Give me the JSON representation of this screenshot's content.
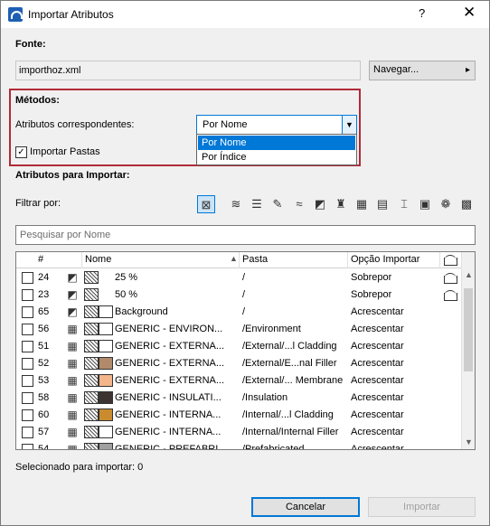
{
  "window": {
    "title": "Importar Atributos",
    "help": "?",
    "close": "✕"
  },
  "source": {
    "label": "Fonte:",
    "file": "importhoz.xml",
    "browse_label": "Navegar...",
    "browse_arrow": "▸"
  },
  "methods": {
    "label": "Métodos:",
    "matching_label": "Atributos correspondentes:",
    "selected": "Por Nome",
    "options": [
      "Por Nome",
      "Por Índice"
    ],
    "import_folders_label": "Importar Pastas",
    "import_folders_checked": true
  },
  "import_section": {
    "label": "Atributos para Importar:",
    "filter_label": "Filtrar por:"
  },
  "filter_icons": [
    "all-attributes-icon",
    "layers-icon",
    "layer-combinations-icon",
    "pens-icon",
    "line-types-icon",
    "fill-types-icon",
    "surfaces-icon",
    "building-materials-icon",
    "composites-icon",
    "profiles-icon",
    "zone-categories-icon",
    "mep-systems-icon",
    "markup-styles-icon"
  ],
  "search": {
    "placeholder": "Pesquisar por Nome"
  },
  "table": {
    "headers": {
      "num": "#",
      "name": "Nome",
      "folder": "Pasta",
      "option": "Opção Importar"
    },
    "rows": [
      {
        "num": "24",
        "icon": "fill-icon",
        "color": "",
        "name": "25 %",
        "folder": "/",
        "option": "Sobrepor",
        "overwrite": true
      },
      {
        "num": "23",
        "icon": "fill-icon",
        "color": "",
        "name": "50 %",
        "folder": "/",
        "option": "Sobrepor",
        "overwrite": true
      },
      {
        "num": "65",
        "icon": "fill-icon",
        "color": "#ffffff",
        "name": "Background",
        "folder": "/",
        "option": "Acrescentar",
        "overwrite": false
      },
      {
        "num": "56",
        "icon": "building-material-icon",
        "color": "#ffffff",
        "name": "GENERIC - ENVIRON...",
        "folder": "/Environment",
        "option": "Acrescentar",
        "overwrite": false
      },
      {
        "num": "51",
        "icon": "building-material-icon",
        "color": "#ffffff",
        "name": "GENERIC - EXTERNA...",
        "folder": "/External/...l Cladding",
        "option": "Acrescentar",
        "overwrite": false
      },
      {
        "num": "52",
        "icon": "building-material-icon",
        "color": "#b08a6a",
        "name": "GENERIC - EXTERNA...",
        "folder": "/External/E...nal Filler",
        "option": "Acrescentar",
        "overwrite": false
      },
      {
        "num": "53",
        "icon": "building-material-icon",
        "color": "#f4b58a",
        "name": "GENERIC - EXTERNA...",
        "folder": "/External/...  Membrane",
        "option": "Acrescentar",
        "overwrite": false
      },
      {
        "num": "58",
        "icon": "building-material-icon",
        "color": "#3d3432",
        "name": "GENERIC - INSULATI...",
        "folder": "/Insulation",
        "option": "Acrescentar",
        "overwrite": false
      },
      {
        "num": "60",
        "icon": "building-material-icon",
        "color": "#c98b2e",
        "name": "GENERIC - INTERNA...",
        "folder": "/Internal/...l Cladding",
        "option": "Acrescentar",
        "overwrite": false
      },
      {
        "num": "57",
        "icon": "building-material-icon",
        "color": "#ffffff",
        "name": "GENERIC - INTERNA...",
        "folder": "/Internal/Internal Filler",
        "option": "Acrescentar",
        "overwrite": false
      },
      {
        "num": "54",
        "icon": "building-material-icon",
        "color": "#a0a0a0",
        "name": "GENERIC - PREFABRI...",
        "folder": "/Prefabricated",
        "option": "Acrescentar",
        "overwrite": false
      }
    ]
  },
  "status": {
    "selected_label": "Selecionado para importar: 0"
  },
  "buttons": {
    "cancel": "Cancelar",
    "import": "Importar"
  }
}
